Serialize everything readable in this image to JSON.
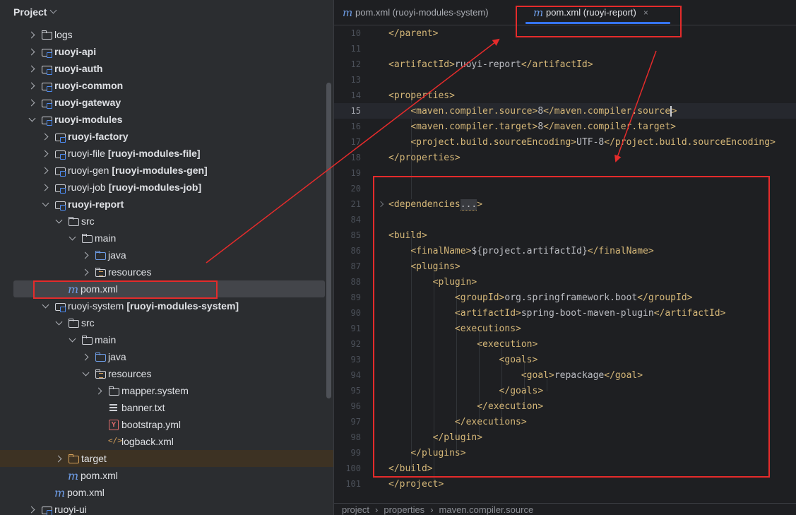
{
  "project_panel": {
    "title": "Project",
    "tree": [
      {
        "label": "logs",
        "suffix": "",
        "arrow": "right",
        "icon": "folder",
        "bold": false
      },
      {
        "label": "ruoyi-api",
        "suffix": "",
        "arrow": "right",
        "icon": "module",
        "bold": true
      },
      {
        "label": "ruoyi-auth",
        "suffix": "",
        "arrow": "right",
        "icon": "module",
        "bold": true
      },
      {
        "label": "ruoyi-common",
        "suffix": "",
        "arrow": "right",
        "icon": "module",
        "bold": true
      },
      {
        "label": "ruoyi-gateway",
        "suffix": "",
        "arrow": "right",
        "icon": "module",
        "bold": true
      },
      {
        "label": "ruoyi-modules",
        "suffix": "",
        "arrow": "down",
        "icon": "module",
        "bold": true
      },
      {
        "label": "ruoyi-factory",
        "suffix": "",
        "arrow": "right",
        "icon": "module",
        "bold": true
      },
      {
        "label": "ruoyi-file",
        "suffix": "[ruoyi-modules-file]",
        "arrow": "right",
        "icon": "module",
        "bold": false
      },
      {
        "label": "ruoyi-gen",
        "suffix": "[ruoyi-modules-gen]",
        "arrow": "right",
        "icon": "module",
        "bold": false
      },
      {
        "label": "ruoyi-job",
        "suffix": "[ruoyi-modules-job]",
        "arrow": "right",
        "icon": "module",
        "bold": false
      },
      {
        "label": "ruoyi-report",
        "suffix": "",
        "arrow": "down",
        "icon": "module",
        "bold": true
      },
      {
        "label": "src",
        "suffix": "",
        "arrow": "down",
        "icon": "folder",
        "bold": false
      },
      {
        "label": "main",
        "suffix": "",
        "arrow": "down",
        "icon": "folder",
        "bold": false
      },
      {
        "label": "java",
        "suffix": "",
        "arrow": "right",
        "icon": "folder-blue",
        "bold": false
      },
      {
        "label": "resources",
        "suffix": "",
        "arrow": "right",
        "icon": "resources",
        "bold": false
      },
      {
        "label": "pom.xml",
        "suffix": "",
        "arrow": "none",
        "icon": "maven",
        "bold": false
      },
      {
        "label": "ruoyi-system",
        "suffix": "[ruoyi-modules-system]",
        "arrow": "down",
        "icon": "module",
        "bold": false
      },
      {
        "label": "src",
        "suffix": "",
        "arrow": "down",
        "icon": "folder",
        "bold": false
      },
      {
        "label": "main",
        "suffix": "",
        "arrow": "down",
        "icon": "folder",
        "bold": false
      },
      {
        "label": "java",
        "suffix": "",
        "arrow": "right",
        "icon": "folder-blue",
        "bold": false
      },
      {
        "label": "resources",
        "suffix": "",
        "arrow": "down",
        "icon": "resources",
        "bold": false
      },
      {
        "label": "mapper.system",
        "suffix": "",
        "arrow": "right",
        "icon": "folder",
        "bold": false
      },
      {
        "label": "banner.txt",
        "suffix": "",
        "arrow": "none",
        "icon": "text-file",
        "bold": false
      },
      {
        "label": "bootstrap.yml",
        "suffix": "",
        "arrow": "none",
        "icon": "yaml-file",
        "bold": false
      },
      {
        "label": "logback.xml",
        "suffix": "",
        "arrow": "none",
        "icon": "xml-file",
        "bold": false
      },
      {
        "label": "target",
        "suffix": "",
        "arrow": "right",
        "icon": "folder-orange",
        "bold": false
      },
      {
        "label": "pom.xml",
        "suffix": "",
        "arrow": "none",
        "icon": "maven",
        "bold": false
      },
      {
        "label": "pom.xml",
        "suffix": "",
        "arrow": "none",
        "icon": "maven",
        "bold": false
      },
      {
        "label": "ruoyi-ui",
        "suffix": "",
        "arrow": "right",
        "icon": "module",
        "bold": false
      }
    ]
  },
  "editor": {
    "tabs": [
      {
        "label": "pom.xml (ruoyi-modules-system)",
        "icon": "maven-icon"
      },
      {
        "label": "pom.xml (ruoyi-report)",
        "icon": "maven-icon",
        "close": "×"
      }
    ],
    "lines": [
      {
        "num": "10",
        "html": "<span class='tg'>&lt;/parent&gt;</span>"
      },
      {
        "num": "11",
        "html": ""
      },
      {
        "num": "12",
        "html": "<span class='tg'>&lt;artifactId&gt;</span>ruoyi-report<span class='tg'>&lt;/artifactId&gt;</span>"
      },
      {
        "num": "13",
        "html": ""
      },
      {
        "num": "14",
        "html": "<span class='tg'>&lt;properties&gt;</span>"
      },
      {
        "num": "15",
        "html": "    <span class='tg'>&lt;maven.compiler.source&gt;</span>8<span class='tg'>&lt;/maven.compiler.source</span><span class='caret'></span><span class='tg'>&gt;</span>"
      },
      {
        "num": "16",
        "html": "    <span class='tg'>&lt;maven.compiler.target&gt;</span>8<span class='tg'>&lt;/maven.compiler.target&gt;</span>"
      },
      {
        "num": "17",
        "html": "    <span class='tg'>&lt;project.build.sourceEncoding&gt;</span>UTF-8<span class='tg'>&lt;/project.build.sourceEncoding&gt;</span>"
      },
      {
        "num": "18",
        "html": "<span class='tg'>&lt;/properties&gt;</span>"
      },
      {
        "num": "19",
        "html": ""
      },
      {
        "num": "20",
        "html": ""
      },
      {
        "num": "21",
        "html": "<span class='tg'>&lt;dependencies</span><span class='ellip'>...</span><span class='tg'>&gt;</span>"
      },
      {
        "num": "84",
        "html": ""
      },
      {
        "num": "85",
        "html": "<span class='tg'>&lt;build&gt;</span>"
      },
      {
        "num": "86",
        "html": "    <span class='tg'>&lt;finalName&gt;</span>${project.artifactId}<span class='tg'>&lt;/finalName&gt;</span>"
      },
      {
        "num": "87",
        "html": "    <span class='tg'>&lt;plugins&gt;</span>"
      },
      {
        "num": "88",
        "html": "        <span class='tg'>&lt;plugin&gt;</span>"
      },
      {
        "num": "89",
        "html": "            <span class='tg'>&lt;groupId&gt;</span>org.springframework.boot<span class='tg'>&lt;/groupId&gt;</span>"
      },
      {
        "num": "90",
        "html": "            <span class='tg'>&lt;artifactId&gt;</span>spring-boot-maven-plugin<span class='tg'>&lt;/artifactId&gt;</span>"
      },
      {
        "num": "91",
        "html": "            <span class='tg'>&lt;executions&gt;</span>"
      },
      {
        "num": "92",
        "html": "                <span class='tg'>&lt;execution&gt;</span>"
      },
      {
        "num": "93",
        "html": "                    <span class='tg'>&lt;goals&gt;</span>"
      },
      {
        "num": "94",
        "html": "                        <span class='tg'>&lt;goal&gt;</span>repackage<span class='tg'>&lt;/goal&gt;</span>"
      },
      {
        "num": "95",
        "html": "                    <span class='tg'>&lt;/goals&gt;</span>"
      },
      {
        "num": "96",
        "html": "                <span class='tg'>&lt;/execution&gt;</span>"
      },
      {
        "num": "97",
        "html": "            <span class='tg'>&lt;/executions&gt;</span>"
      },
      {
        "num": "98",
        "html": "        <span class='tg'>&lt;/plugin&gt;</span>"
      },
      {
        "num": "99",
        "html": "    <span class='tg'>&lt;/plugins&gt;</span>"
      },
      {
        "num": "100",
        "html": "<span class='tg'>&lt;/build&gt;</span>"
      },
      {
        "num": "101",
        "html": "<span class='tg'>&lt;/project&gt;</span>"
      }
    ],
    "breadcrumbs": [
      "project",
      "properties",
      "maven.compiler.source"
    ]
  },
  "colors": {
    "annotation": "#e52b2b",
    "accent": "#3574f0",
    "tag": "#d5b778"
  }
}
